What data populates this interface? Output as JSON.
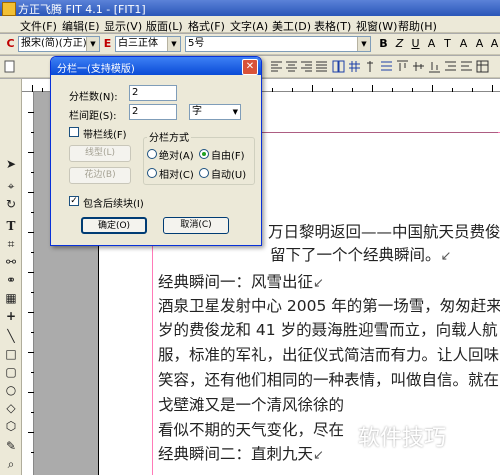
{
  "window": {
    "title": "方正飞腾 FIT 4.1 - [FIT1]"
  },
  "menu": [
    "文件(F)",
    "编辑(E)",
    "显示(V)",
    "版面(L)",
    "格式(F)",
    "文字(A)",
    "美工(D)",
    "表格(T)",
    "视窗(W)",
    "帮助(H)"
  ],
  "font_toolbar": {
    "font_cn_label": "C",
    "font_cn": "报宋(简)(方正)",
    "font_en_label": "E",
    "font_en": "白三正体",
    "size": "5号",
    "style_buttons": [
      "B",
      "Z",
      "U",
      "A",
      "T",
      "A",
      "A",
      "A"
    ]
  },
  "dialog": {
    "title": "分栏一(支持模版)",
    "columns_label": "分栏数(N):",
    "columns_value": "2",
    "gutter_label": "栏间距(S):",
    "gutter_value": "2",
    "gutter_unit": "字",
    "divider_label": "带栏线(F)",
    "divider_checked": false,
    "line_button": "线型(L)",
    "color_button": "花边(B)",
    "method_group": "分栏方式",
    "radio_absolute": "绝对(A)",
    "radio_free": "自由(F)",
    "radio_relative": "相对(C)",
    "radio_auto": "自动(U)",
    "include_label": "包含后续块(I)",
    "include_checked": true,
    "ok": "确定(O)",
    "cancel": "取消(C)"
  },
  "document": {
    "lines": [
      "万日黎明返回——中国航天员费俊",
      "留下了一个个经典瞬间。",
      "经典瞬间一：风雪出征",
      "酒泉卫星发射中心 2005 年的第一场雪，匆匆赶来",
      "岁的费俊龙和 41 岁的聂海胜迎雪而立，向载人航",
      "服，标准的军礼，出征仪式简洁而有力。让人回味",
      "笑容，还有他们相同的一种表情，叫做自信。就在",
      "戈壁滩又是一个清风徐徐的",
      "看似不期的天气变化，尽在",
      "经典瞬间二：直刺九天"
    ]
  },
  "watermark": "软件技巧"
}
